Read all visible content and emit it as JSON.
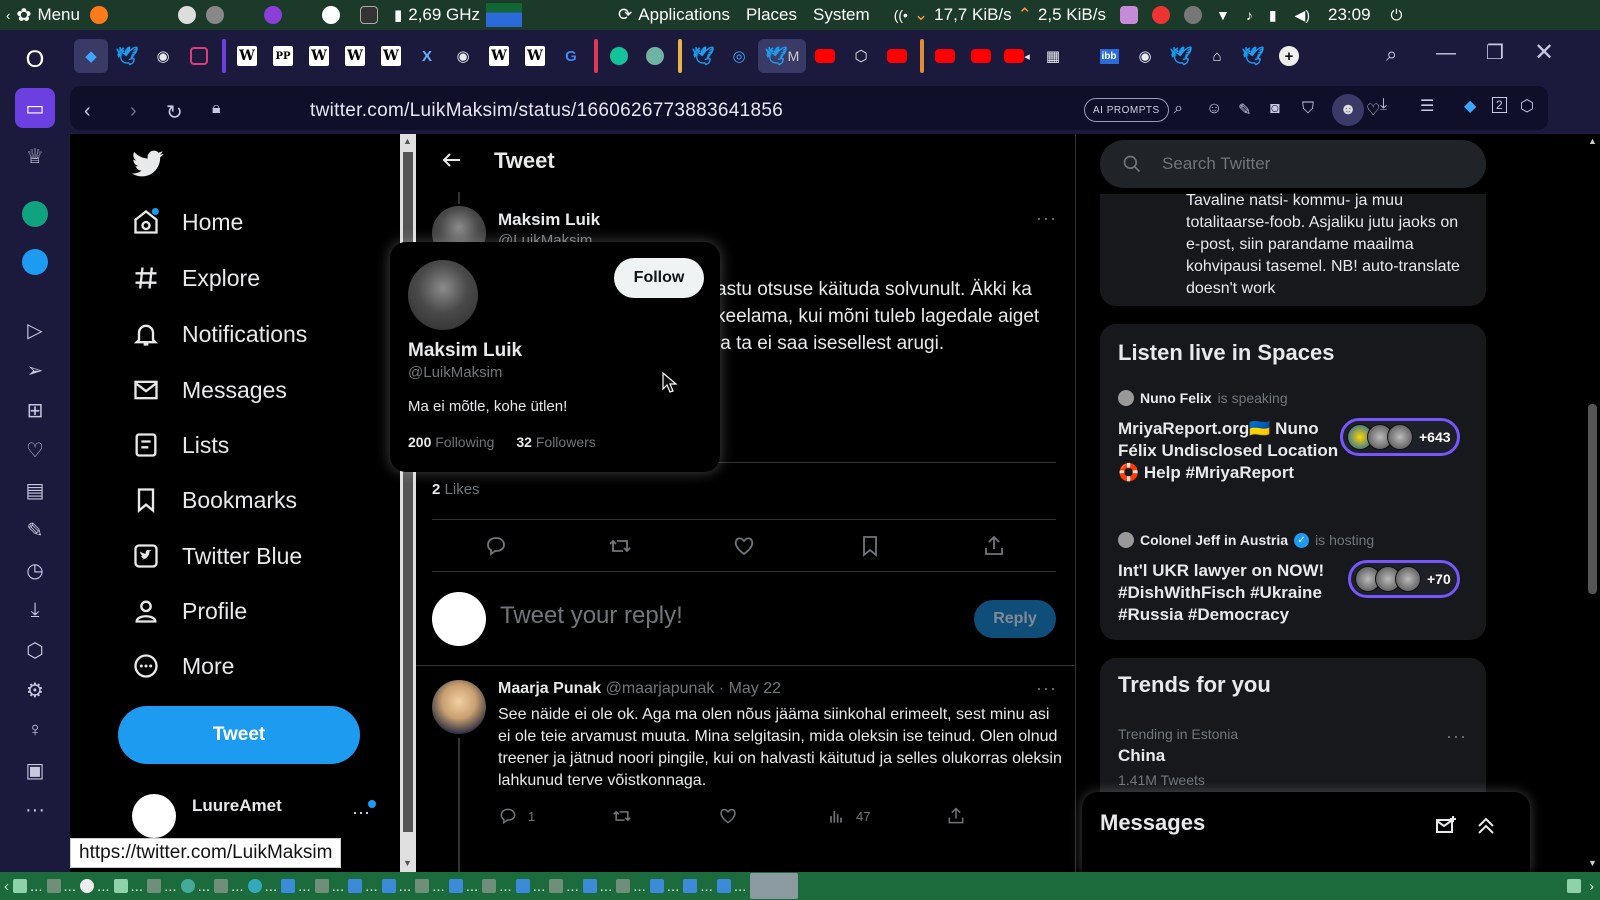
{
  "system_panel": {
    "menu_label": "Menu",
    "cpu_freq": "2,69 GHz",
    "applications_label": "Applications",
    "places_label": "Places",
    "system_label": "System",
    "net_down": "17,7 KiB/s",
    "net_up": "2,5 KiB/s",
    "clock": "23:09"
  },
  "browser": {
    "url": "twitter.com/LuikMaksim/status/1660626773883641856",
    "ai_prompts_label": "AI PROMPTS",
    "notification_count": "2",
    "status_link": "https://twitter.com/LuikMaksim",
    "tabs": [
      {
        "icon": "twitter-icon"
      },
      {
        "icon": "globe-icon"
      },
      {
        "icon": "wikipedia-icon",
        "glyph": "W"
      },
      {
        "icon": "pp-icon",
        "glyph": "PP"
      },
      {
        "icon": "wikipedia-icon",
        "glyph": "W"
      },
      {
        "icon": "wikipedia-icon",
        "glyph": "W"
      },
      {
        "icon": "wikipedia-icon",
        "glyph": "W"
      },
      {
        "icon": "youtube-icon"
      }
    ]
  },
  "twitter": {
    "nav": {
      "home": "Home",
      "explore": "Explore",
      "notifications": "Notifications",
      "messages": "Messages",
      "lists": "Lists",
      "bookmarks": "Bookmarks",
      "twitter_blue": "Twitter Blue",
      "profile": "Profile",
      "more": "More",
      "tweet_button": "Tweet",
      "account_name": "LuureAmet"
    },
    "column_title": "Tweet",
    "author": {
      "name": "Maksim Luik",
      "handle": "@LuikMaksim"
    },
    "tweet_text_visible": "astu otsuse käituda solvunult. Äkki ka keelama, kui mõni tuleb lagedale aiget ja ta ei saa isesellest arugi.",
    "likes_count": "2",
    "likes_label": "Likes",
    "reply": {
      "placeholder": "Tweet your reply!",
      "button": "Reply"
    },
    "hover_card": {
      "name": "Maksim Luik",
      "handle": "@LuikMaksim",
      "follow_button": "Follow",
      "bio": "Ma ei mõtle, kohe ütlen!",
      "following_count": "200",
      "following_label": "Following",
      "followers_count": "32",
      "followers_label": "Followers"
    },
    "comment": {
      "name": "Maarja Punak",
      "meta": "@maarjapunak · May 22",
      "text": "See näide ei ole ok. Aga ma olen nõus jääma siinkohal erimeelt, sest minu asi ei ole teie arvamust muuta. Mina selgitasin, mida oleksin ise teinud. Olen olnud treener ja jätnud noori pingile, kui on halvasti käitutud ja selles olukorras oleksin lahkunud terve võistkonnaga.",
      "reply_count": "1",
      "views_count": "47"
    },
    "right": {
      "search_placeholder": "Search Twitter",
      "prev_card_text": "Tavaline natsi- kommu- ja muu totalitaarse-foob. Asjaliku jutu jaoks on e-post, siin parandame maailma kohvipausi tasemel. NB! auto-translate doesn't work",
      "spaces_title": "Listen live in Spaces",
      "spaces": [
        {
          "speaker": "Nuno Felix",
          "role": "is speaking",
          "title": "MriyaReport.org🇺🇦 Nuno Félix Undisclosed Location 🛟 Help #MriyaReport",
          "listeners": "+643"
        },
        {
          "speaker": "Colonel Jeff in Austria",
          "role": "is hosting",
          "title": "Int'l UKR lawyer on NOW! #DishWithFisch #Ukraine #Russia #Democracy",
          "listeners": "+70"
        }
      ],
      "trends_title": "Trends for you",
      "trend": {
        "context": "Trending in Estonia",
        "name": "China",
        "count": "1.41M Tweets"
      }
    },
    "messages_drawer_title": "Messages"
  }
}
